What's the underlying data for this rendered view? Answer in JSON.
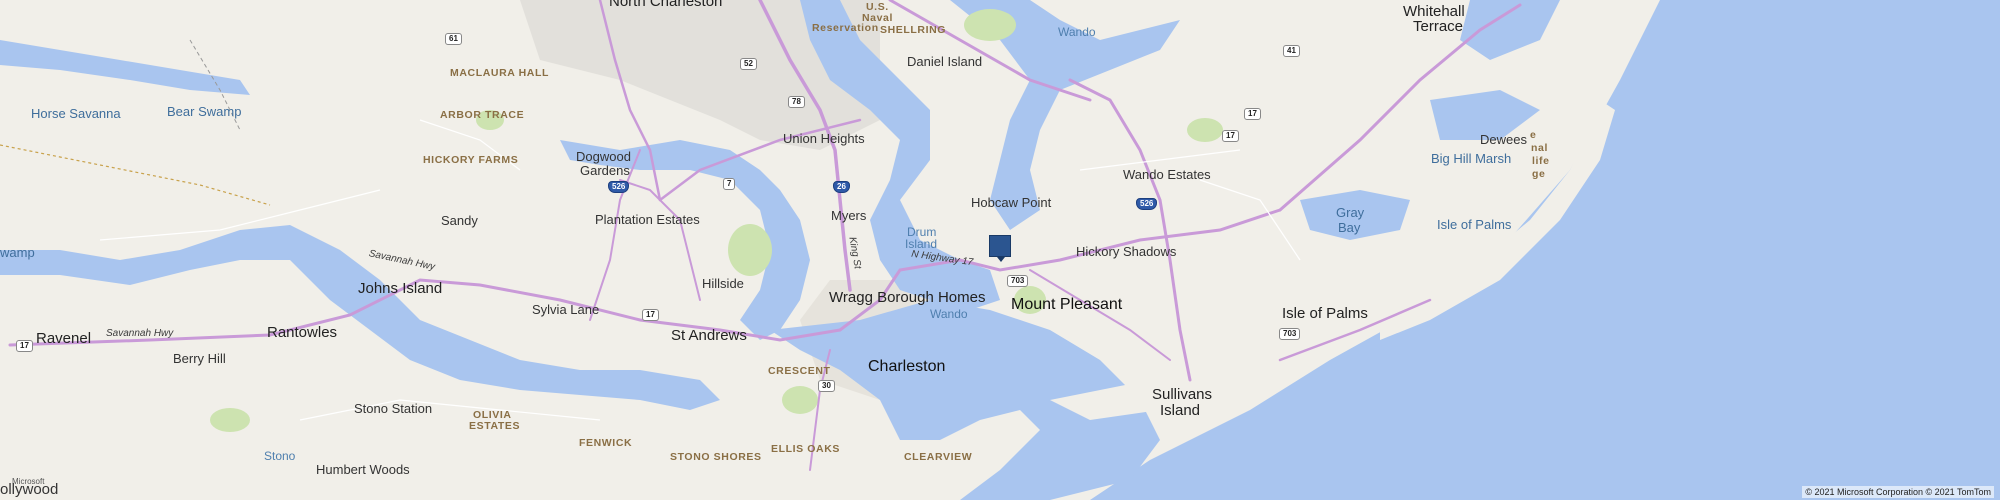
{
  "map": {
    "marker": {
      "name": "location-pin-icon",
      "color": "#2b5590"
    },
    "colors": {
      "water": "#a9c5ef",
      "land": "#f1efe9",
      "highway": "#c99ad8",
      "park": "#cde3b0"
    },
    "labels": {
      "north_charleston": "North Charleston",
      "us_naval_1": "U.S.",
      "us_naval_2": "Naval",
      "us_naval_3": "Reservation",
      "shellring": "SHELLRING",
      "wando_top": "Wando",
      "whitehall_1": "Whitehall",
      "whitehall_2": "Terrace",
      "daniel_island": "Daniel Island",
      "maclaura_hall": "MACLAURA HALL",
      "horse_savanna": "Horse Savanna",
      "bear_swamp": "Bear Swamp",
      "arbor_trace": "ARBOR TRACE",
      "hickory_farms": "HICKORY FARMS",
      "union_heights": "Union Heights",
      "dogwood_1": "Dogwood",
      "dogwood_2": "Gardens",
      "dewees": "Dewees",
      "big_hill_marsh": "Big Hill Marsh",
      "wando_estates": "Wando Estates",
      "hobcaw_point": "Hobcaw Point",
      "myers": "Myers",
      "sandy": "Sandy",
      "plantation_estates": "Plantation Estates",
      "gray_bay_1": "Gray",
      "gray_bay_2": "Bay",
      "isle_of_palms_water": "Isle of Palms",
      "drum_1": "Drum",
      "drum_2": "Island",
      "swamp": "wamp",
      "hickory_shadows": "Hickory Shadows",
      "savannah_hwy_1": "Savannah Hwy",
      "savannah_hwy_2": "Savannah Hwy",
      "n_highway_17": "N Highway 17",
      "king_st": "King St",
      "hillside": "Hillside",
      "johns_island": "Johns Island",
      "sylvia_lane": "Sylvia Lane",
      "wragg_borough": "Wragg Borough Homes",
      "mount_pleasant": "Mount Pleasant",
      "wando_mid": "Wando",
      "isle_of_palms": "Isle of Palms",
      "ravenel": "Ravenel",
      "rantowles": "Rantowles",
      "st_andrews": "St Andrews",
      "berry_hill": "Berry Hill",
      "crescent": "CRESCENT",
      "charleston": "Charleston",
      "sullivans_1": "Sullivans",
      "sullivans_2": "Island",
      "stono_station": "Stono Station",
      "olivia_1": "OLIVIA",
      "olivia_2": "ESTATES",
      "fenwick": "FENWICK",
      "ellis_oaks": "ELLIS OAKS",
      "clearview": "CLEARVIEW",
      "stono": "Stono",
      "stono_shores": "STONO SHORES",
      "humbert_woods": "Humbert Woods",
      "hollywood": "ollywood",
      "ms_small": "Microsoft",
      "wildlife_1": "e",
      "wildlife_2": "nal",
      "wildlife_3": "life",
      "wildlife_4": "ge"
    },
    "shields": {
      "us61": "61",
      "us52": "52",
      "us78": "78",
      "us41": "41",
      "us17a": "17",
      "us17b": "17",
      "us17c": "17",
      "us17d": "17",
      "sc7": "7",
      "i26": "26",
      "i526a": "526",
      "i526b": "526",
      "sc703a": "703",
      "sc703b": "703",
      "sc30": "30"
    },
    "copyright": "© 2021 Microsoft Corporation © 2021 TomTom"
  }
}
